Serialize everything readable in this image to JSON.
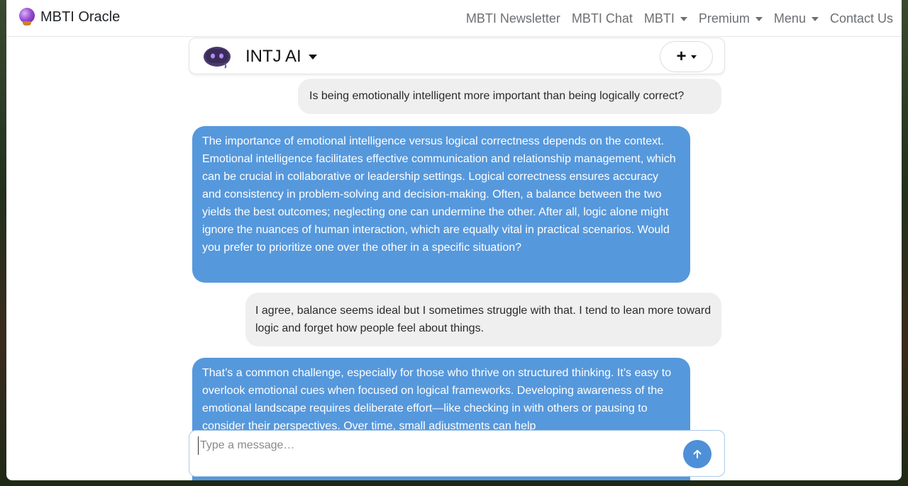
{
  "navbar": {
    "brand": "MBTI Oracle",
    "links": [
      {
        "label": "MBTI Newsletter",
        "dropdown": false
      },
      {
        "label": "MBTI Chat",
        "dropdown": false
      },
      {
        "label": "MBTI",
        "dropdown": true
      },
      {
        "label": "Premium",
        "dropdown": true
      },
      {
        "label": "Menu",
        "dropdown": true
      },
      {
        "label": "Contact Us",
        "dropdown": false
      }
    ]
  },
  "chat_header": {
    "bot_name": "INTJ AI",
    "new_button_label": "+"
  },
  "messages": [
    {
      "role": "user",
      "text": "Is being emotionally intelligent more important than being logically correct?"
    },
    {
      "role": "bot",
      "text": "The importance of emotional intelligence versus logical correctness depends on the context. Emotional intelligence facilitates effective communication and relationship management, which can be crucial in collaborative or leadership settings. Logical correctness ensures accuracy and consistency in problem-solving and decision-making. Often, a balance between the two yields the best outcomes; neglecting one can undermine the other. After all, logic alone might ignore the nuances of human interaction, which are equally vital in practical scenarios. Would you prefer to prioritize one over the other in a specific situation?"
    },
    {
      "role": "user",
      "text": "I agree, balance seems ideal but I sometimes struggle with that. I tend to lean more toward logic and forget how people feel about things."
    },
    {
      "role": "bot",
      "text": "That’s a common challenge, especially for those who thrive on structured thinking. It’s easy to overlook emotional cues when focused on logical frameworks. Developing awareness of the emotional landscape requires deliberate effort—like checking in with others or pausing to consider their perspectives. Over time, small adjustments can help"
    }
  ],
  "composer": {
    "placeholder": "Type a message…",
    "value": ""
  },
  "colors": {
    "bot_bubble": "#5698dc",
    "user_bubble": "#efefef",
    "send_button": "#4d90d8"
  }
}
